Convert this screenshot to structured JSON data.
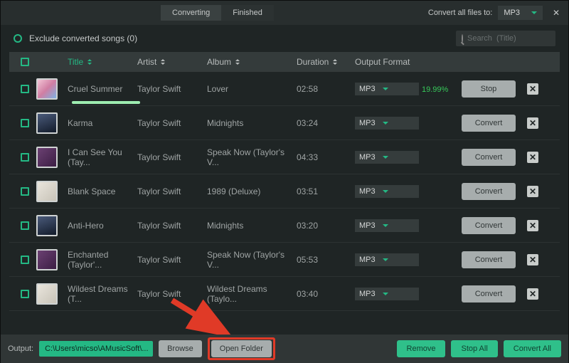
{
  "topbar": {
    "tabs": {
      "converting": "Converting",
      "finished": "Finished"
    },
    "convert_label": "Convert all files to:",
    "global_format": "MP3"
  },
  "subhead": {
    "exclude_label": "Exclude converted songs (0)",
    "search_placeholder": "Search  (Title)"
  },
  "columns": {
    "title": "Title",
    "artist": "Artist",
    "album": "Album",
    "duration": "Duration",
    "output_format": "Output Format"
  },
  "tracks": [
    {
      "title": "Cruel Summer",
      "artist": "Taylor Swift",
      "album": "Lover",
      "duration": "02:58",
      "format": "MP3",
      "progress": "19.99%",
      "state": "converting"
    },
    {
      "title": "Karma",
      "artist": "Taylor Swift",
      "album": "Midnights",
      "duration": "03:24",
      "format": "MP3",
      "progress": "",
      "state": "idle"
    },
    {
      "title": "I Can See You (Tay...",
      "artist": "Taylor Swift",
      "album": "Speak Now (Taylor's V...",
      "duration": "04:33",
      "format": "MP3",
      "progress": "",
      "state": "idle"
    },
    {
      "title": "Blank Space",
      "artist": "Taylor Swift",
      "album": "1989 (Deluxe)",
      "duration": "03:51",
      "format": "MP3",
      "progress": "",
      "state": "idle"
    },
    {
      "title": "Anti-Hero",
      "artist": "Taylor Swift",
      "album": "Midnights",
      "duration": "03:20",
      "format": "MP3",
      "progress": "",
      "state": "idle"
    },
    {
      "title": "Enchanted (Taylor'...",
      "artist": "Taylor Swift",
      "album": "Speak Now (Taylor's V...",
      "duration": "05:53",
      "format": "MP3",
      "progress": "",
      "state": "idle"
    },
    {
      "title": "Wildest Dreams (T...",
      "artist": "Taylor Swift",
      "album": "Wildest Dreams (Taylo...",
      "duration": "03:40",
      "format": "MP3",
      "progress": "",
      "state": "idle"
    }
  ],
  "buttons": {
    "stop": "Stop",
    "convert": "Convert"
  },
  "footer": {
    "output_label": "Output:",
    "path": "C:\\Users\\micso\\AMusicSoft\\...",
    "browse": "Browse",
    "open_folder": "Open Folder",
    "remove": "Remove",
    "stop_all": "Stop All",
    "convert_all": "Convert All"
  }
}
